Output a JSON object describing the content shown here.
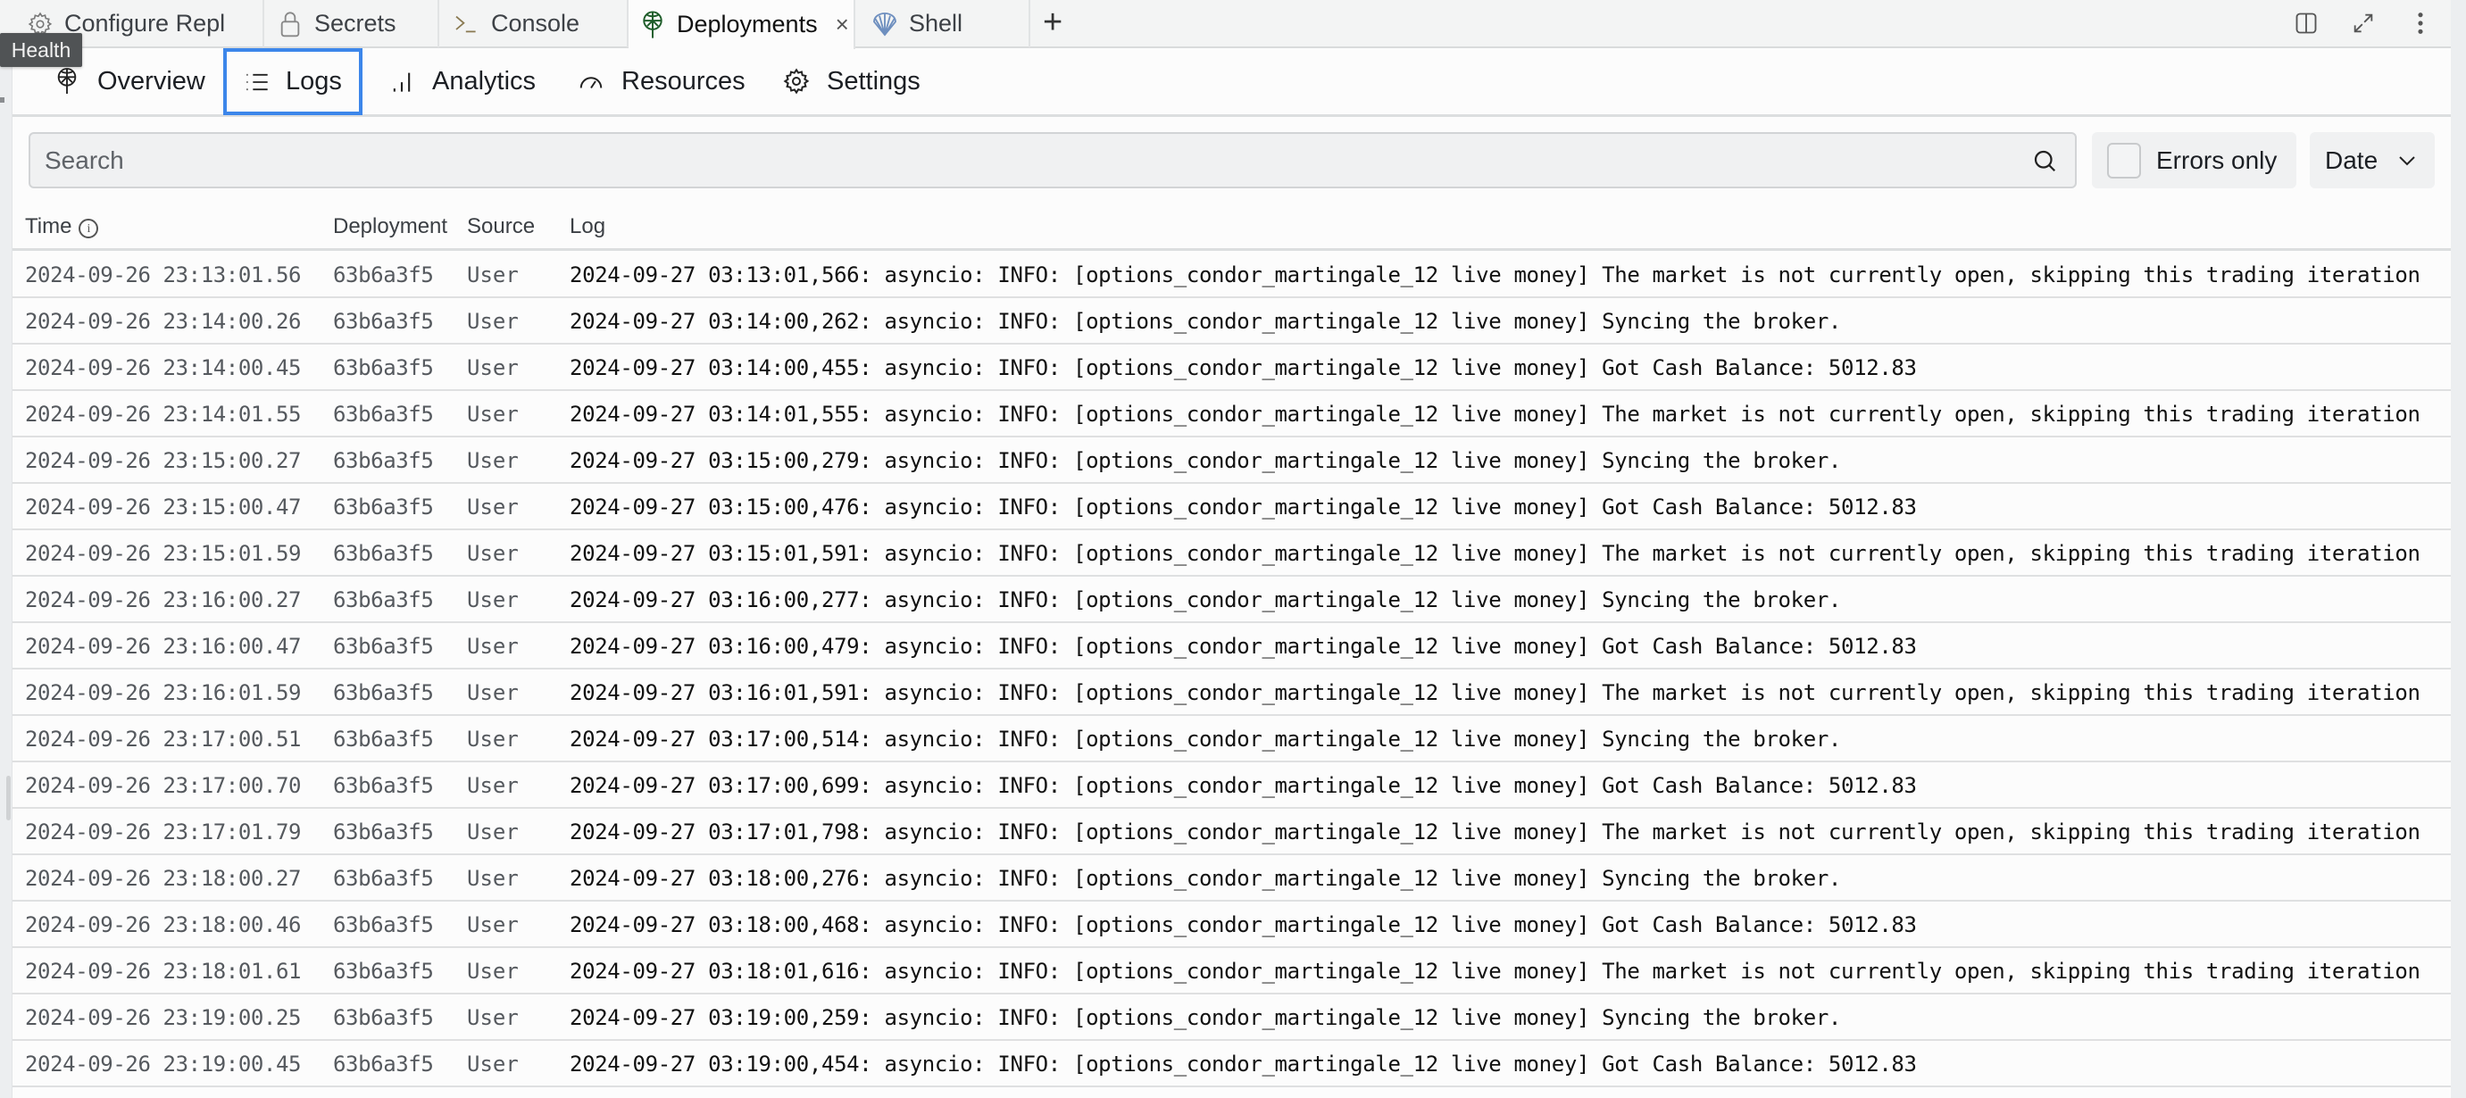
{
  "tabs": [
    {
      "label": "Configure Repl",
      "icon": "gear-icon"
    },
    {
      "label": "Secrets",
      "icon": "lock-icon"
    },
    {
      "label": "Console",
      "icon": "terminal-icon"
    },
    {
      "label": "Deployments",
      "icon": "deployments-icon",
      "active": true,
      "closable": true
    },
    {
      "label": "Shell",
      "icon": "shell-icon"
    }
  ],
  "tab_add_label": "+",
  "tab_close_label": "×",
  "tooltip": "Health",
  "subnav": [
    {
      "label": "Overview",
      "icon": "deployments-icon"
    },
    {
      "label": "Logs",
      "icon": "list-icon",
      "active": true
    },
    {
      "label": "Analytics",
      "icon": "bar-chart-icon"
    },
    {
      "label": "Resources",
      "icon": "gauge-icon"
    },
    {
      "label": "Settings",
      "icon": "gear-icon"
    }
  ],
  "toolbar": {
    "search_placeholder": "Search",
    "search_value": "",
    "errors_only_label": "Errors only",
    "errors_only_checked": false,
    "date_label": "Date"
  },
  "colors": {
    "accent_focus": "#3c86ea",
    "deployments_icon": "#1f5d2a",
    "shell_icon": "#6e8fbf"
  },
  "table": {
    "columns": [
      "Time",
      "Deployment",
      "Source",
      "Log"
    ],
    "rows": [
      {
        "time": "2024-09-26 23:13:01.56",
        "deployment": "63b6a3f5",
        "source": "User",
        "log": "2024-09-27 03:13:01,566: asyncio: INFO: [options_condor_martingale_12 live money] The market is not currently open, skipping this trading iteration"
      },
      {
        "time": "2024-09-26 23:14:00.26",
        "deployment": "63b6a3f5",
        "source": "User",
        "log": "2024-09-27 03:14:00,262: asyncio: INFO: [options_condor_martingale_12 live money] Syncing the broker."
      },
      {
        "time": "2024-09-26 23:14:00.45",
        "deployment": "63b6a3f5",
        "source": "User",
        "log": "2024-09-27 03:14:00,455: asyncio: INFO: [options_condor_martingale_12 live money] Got Cash Balance: 5012.83"
      },
      {
        "time": "2024-09-26 23:14:01.55",
        "deployment": "63b6a3f5",
        "source": "User",
        "log": "2024-09-27 03:14:01,555: asyncio: INFO: [options_condor_martingale_12 live money] The market is not currently open, skipping this trading iteration"
      },
      {
        "time": "2024-09-26 23:15:00.27",
        "deployment": "63b6a3f5",
        "source": "User",
        "log": "2024-09-27 03:15:00,279: asyncio: INFO: [options_condor_martingale_12 live money] Syncing the broker."
      },
      {
        "time": "2024-09-26 23:15:00.47",
        "deployment": "63b6a3f5",
        "source": "User",
        "log": "2024-09-27 03:15:00,476: asyncio: INFO: [options_condor_martingale_12 live money] Got Cash Balance: 5012.83"
      },
      {
        "time": "2024-09-26 23:15:01.59",
        "deployment": "63b6a3f5",
        "source": "User",
        "log": "2024-09-27 03:15:01,591: asyncio: INFO: [options_condor_martingale_12 live money] The market is not currently open, skipping this trading iteration"
      },
      {
        "time": "2024-09-26 23:16:00.27",
        "deployment": "63b6a3f5",
        "source": "User",
        "log": "2024-09-27 03:16:00,277: asyncio: INFO: [options_condor_martingale_12 live money] Syncing the broker."
      },
      {
        "time": "2024-09-26 23:16:00.47",
        "deployment": "63b6a3f5",
        "source": "User",
        "log": "2024-09-27 03:16:00,479: asyncio: INFO: [options_condor_martingale_12 live money] Got Cash Balance: 5012.83"
      },
      {
        "time": "2024-09-26 23:16:01.59",
        "deployment": "63b6a3f5",
        "source": "User",
        "log": "2024-09-27 03:16:01,591: asyncio: INFO: [options_condor_martingale_12 live money] The market is not currently open, skipping this trading iteration"
      },
      {
        "time": "2024-09-26 23:17:00.51",
        "deployment": "63b6a3f5",
        "source": "User",
        "log": "2024-09-27 03:17:00,514: asyncio: INFO: [options_condor_martingale_12 live money] Syncing the broker."
      },
      {
        "time": "2024-09-26 23:17:00.70",
        "deployment": "63b6a3f5",
        "source": "User",
        "log": "2024-09-27 03:17:00,699: asyncio: INFO: [options_condor_martingale_12 live money] Got Cash Balance: 5012.83"
      },
      {
        "time": "2024-09-26 23:17:01.79",
        "deployment": "63b6a3f5",
        "source": "User",
        "log": "2024-09-27 03:17:01,798: asyncio: INFO: [options_condor_martingale_12 live money] The market is not currently open, skipping this trading iteration"
      },
      {
        "time": "2024-09-26 23:18:00.27",
        "deployment": "63b6a3f5",
        "source": "User",
        "log": "2024-09-27 03:18:00,276: asyncio: INFO: [options_condor_martingale_12 live money] Syncing the broker."
      },
      {
        "time": "2024-09-26 23:18:00.46",
        "deployment": "63b6a3f5",
        "source": "User",
        "log": "2024-09-27 03:18:00,468: asyncio: INFO: [options_condor_martingale_12 live money] Got Cash Balance: 5012.83"
      },
      {
        "time": "2024-09-26 23:18:01.61",
        "deployment": "63b6a3f5",
        "source": "User",
        "log": "2024-09-27 03:18:01,616: asyncio: INFO: [options_condor_martingale_12 live money] The market is not currently open, skipping this trading iteration"
      },
      {
        "time": "2024-09-26 23:19:00.25",
        "deployment": "63b6a3f5",
        "source": "User",
        "log": "2024-09-27 03:19:00,259: asyncio: INFO: [options_condor_martingale_12 live money] Syncing the broker."
      },
      {
        "time": "2024-09-26 23:19:00.45",
        "deployment": "63b6a3f5",
        "source": "User",
        "log": "2024-09-27 03:19:00,454: asyncio: INFO: [options_condor_martingale_12 live money] Got Cash Balance: 5012.83"
      }
    ]
  }
}
